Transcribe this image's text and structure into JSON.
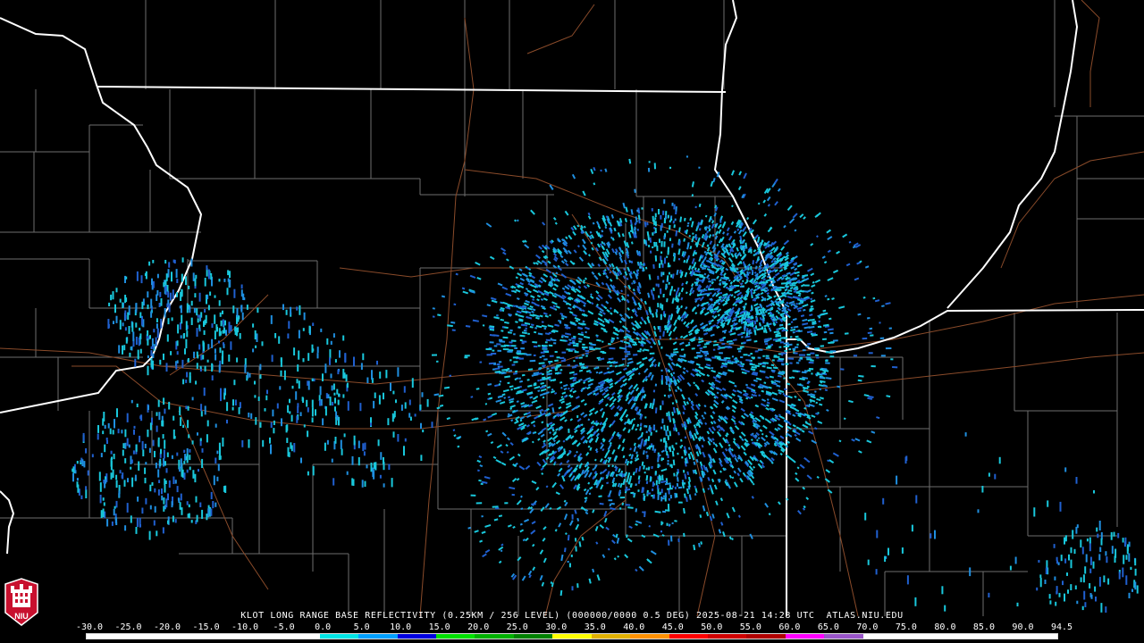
{
  "caption": "KLOT LONG RANGE BASE REFLECTIVITY (0.25KM / 256 LEVEL) (000000/0000 0.5 DEG) 2025-08-21 14:28 UTC  ATLAS.NIU.EDU",
  "logo_text": "NIU",
  "colorbar": {
    "labels": [
      "-30.0",
      "-25.0",
      "-20.0",
      "-15.0",
      "-10.0",
      "-5.0",
      "0.0",
      "5.0",
      "10.0",
      "15.0",
      "20.0",
      "25.0",
      "30.0",
      "35.0",
      "40.0",
      "45.0",
      "50.0",
      "55.0",
      "60.0",
      "65.0",
      "70.0",
      "75.0",
      "80.0",
      "85.0",
      "90.0",
      "94.5"
    ],
    "colors": [
      "#ffffff",
      "#ffffff",
      "#ffffff",
      "#ffffff",
      "#ffffff",
      "#ffffff",
      "#00e5e5",
      "#00a0ff",
      "#0000e0",
      "#00e000",
      "#00b000",
      "#008000",
      "#ffff00",
      "#e0b000",
      "#ff9000",
      "#ff0000",
      "#d00000",
      "#b00000",
      "#ff00ff",
      "#9955c9",
      "#ffffff",
      "#ffffff",
      "#ffffff",
      "#ffffff",
      "#ffffff"
    ]
  },
  "colors": {
    "background": "#000000",
    "state_border": "#ffffff",
    "county_line": "#6e6e6e",
    "road": "#8a4b2a",
    "echo_light": "#19c8dc",
    "echo_mid": "#1f8fe0",
    "echo_dark": "#2060d0"
  }
}
